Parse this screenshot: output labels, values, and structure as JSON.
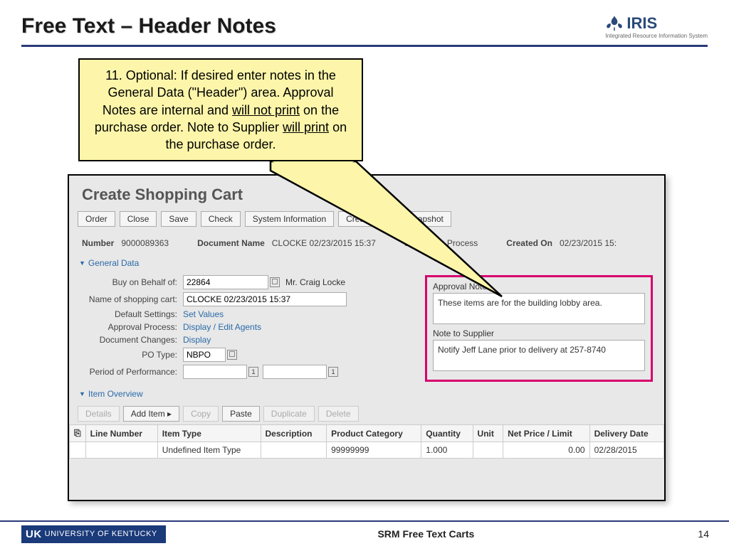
{
  "slide": {
    "title": "Free Text – Header Notes",
    "logo_text": "IRIS",
    "logo_sub": "Integrated Resource Information System",
    "page_number": "14",
    "footer_title": "SRM Free Text Carts",
    "uk_name": "UNIVERSITY OF KENTUCKY",
    "uk_short": "UK"
  },
  "callout": {
    "prefix": "11. Optional: If desired enter notes in the General Data (\"Header\") area. Approval Notes are internal and ",
    "u1": "will not print",
    "mid": " on the purchase order. Note to Supplier ",
    "u2": "will print",
    "suffix": " on the purchase order."
  },
  "sc": {
    "title": "Create Shopping Cart",
    "buttons": [
      "Order",
      "Close",
      "Save",
      "Check",
      "System Information",
      "Create Memory Snapshot"
    ],
    "info": {
      "number_lbl": "Number",
      "number": "9000089363",
      "docname_lbl": "Document Name",
      "docname": "CLOCKE 02/23/2015 15:37",
      "status_lbl": "Status",
      "status": "In Process",
      "created_lbl": "Created On",
      "created": "02/23/2015 15:"
    },
    "general_hdr": "General Data",
    "fields": {
      "buy_lbl": "Buy on Behalf of:",
      "buy_val": "22864",
      "buy_name": "Mr. Craig Locke",
      "cart_lbl": "Name of shopping cart:",
      "cart_val": "CLOCKE 02/23/2015 15:37",
      "defset_lbl": "Default Settings:",
      "defset_val": "Set Values",
      "appr_lbl": "Approval Process:",
      "appr_val": "Display / Edit Agents",
      "docch_lbl": "Document Changes:",
      "docch_val": "Display",
      "pot_lbl": "PO Type:",
      "pot_val": "NBPO",
      "pop_lbl": "Period of Performance:"
    },
    "notes": {
      "appr_lbl": "Approval Note",
      "appr_val": "These items are for the building lobby area.",
      "supp_lbl": "Note to Supplier",
      "supp_val": "Notify Jeff Lane prior to delivery at 257-8740"
    },
    "item_hdr": "Item Overview",
    "item_buttons": {
      "details": "Details",
      "add": "Add Item",
      "copy": "Copy",
      "paste": "Paste",
      "dup": "Duplicate",
      "del": "Delete"
    },
    "cols": [
      "Line Number",
      "Item Type",
      "Description",
      "Product Category",
      "Quantity",
      "Unit",
      "Net Price / Limit",
      "Delivery Date"
    ],
    "row": {
      "type": "Undefined Item Type",
      "cat": "99999999",
      "qty": "1.000",
      "price": "0.00",
      "date": "02/28/2015"
    }
  }
}
